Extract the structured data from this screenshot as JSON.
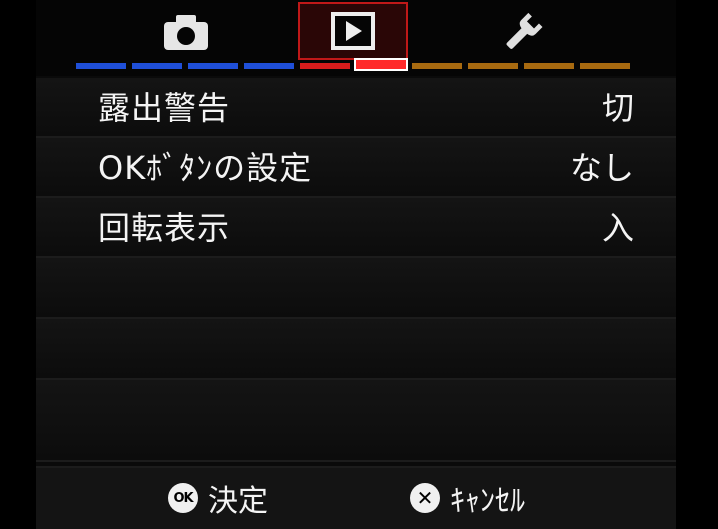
{
  "tabs": [
    {
      "id": "shooting",
      "icon": "camera-icon",
      "selected": false
    },
    {
      "id": "playback",
      "icon": "play-icon",
      "selected": true
    },
    {
      "id": "setup",
      "icon": "wrench-icon",
      "selected": false
    }
  ],
  "colors": {
    "shooting": "#1f4fd8",
    "playback": "#d81c1c",
    "setup": "#a86a10",
    "active_indicator": "#ff2a2a"
  },
  "menu": {
    "rows": [
      {
        "label": "露出警告",
        "value": "切"
      },
      {
        "label": "OKﾎﾞﾀﾝの設定",
        "value": "なし"
      },
      {
        "label": "回転表示",
        "value": "入"
      }
    ]
  },
  "footer": {
    "ok_badge": "OK",
    "ok_label": "決定",
    "cancel_badge": "✕",
    "cancel_label": "ｷｬﾝｾﾙ"
  }
}
